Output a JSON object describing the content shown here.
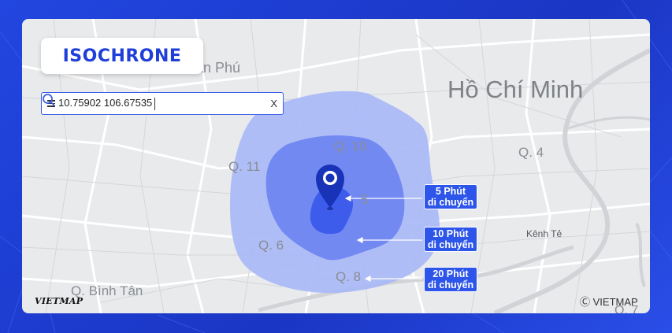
{
  "title": "ISOCHRONE",
  "search": {
    "value": "10.75902 106.67535",
    "icons": [
      "menu-icon",
      "search-icon",
      "close-icon"
    ],
    "close_label": "X"
  },
  "places": {
    "tan_phu": "ân Phú",
    "ho_chi_minh": "Hồ Chí Minh",
    "q10": "Q. 10",
    "q11": "Q. 11",
    "q4": "Q. 4",
    "q5": "5",
    "q6": "Q. 6",
    "q8": "Q. 8",
    "binh_tan": "Q. Bình Tân",
    "kenh_te": "Kênh Tẻ",
    "q7_partial": "Q. 7"
  },
  "callouts": [
    {
      "line1": "5 Phút",
      "line2": "di chuyển"
    },
    {
      "line1": "10 Phút",
      "line2": "di chuyển"
    },
    {
      "line1": "20 Phút",
      "line2": "di chuyển"
    }
  ],
  "logo": "VIETMAP",
  "copyright": "Ⓒ VIETMAP",
  "colors": {
    "zone_20": "#a9b8f7",
    "zone_10": "#6f86f0",
    "zone_5": "#3d5cec",
    "accent": "#1f3fd8",
    "pin": "#1833b8"
  }
}
